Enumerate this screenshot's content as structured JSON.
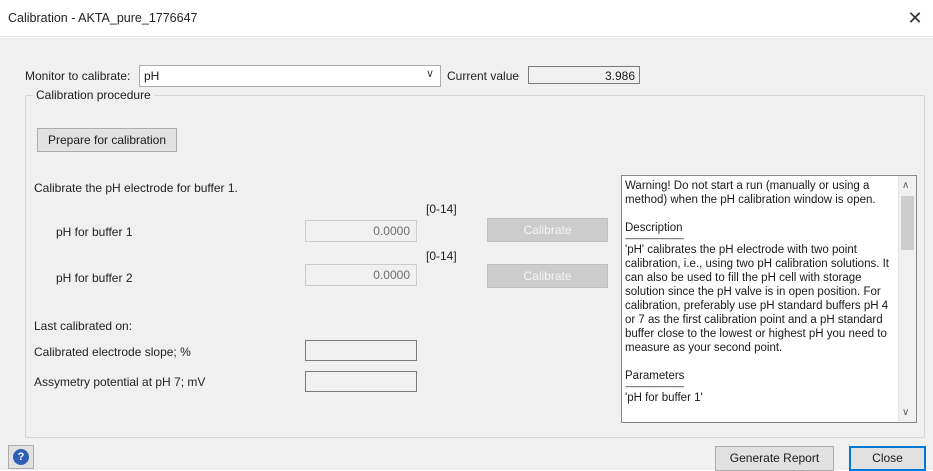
{
  "window": {
    "title": "Calibration - AKTA_pure_1776647",
    "close_symbol": "✕"
  },
  "monitor": {
    "label": "Monitor to calibrate:",
    "selected": "pH",
    "current_value_label": "Current value",
    "current_value": "3.986"
  },
  "procedure": {
    "group_title": "Calibration procedure",
    "prepare_button": "Prepare for calibration",
    "instruction": "Calibrate the pH electrode for buffer 1.",
    "buffers": [
      {
        "label": "pH for buffer 1",
        "range": "[0-14]",
        "value": "0.0000",
        "button": "Calibrate"
      },
      {
        "label": "pH for buffer 2",
        "range": "[0-14]",
        "value": "0.0000",
        "button": "Calibrate"
      }
    ],
    "last_calibrated": "Last calibrated on:",
    "slope_label": "Calibrated electrode slope; %",
    "asym_label": "Assymetry potential at pH 7; mV"
  },
  "description": {
    "warning": "Warning! Do not start a run (manually or using a method) when the pH calibration window is open.",
    "heading": "Description",
    "divider": "-----------------------------------",
    "body": "'pH' calibrates the pH electrode with two point calibration, i.e., using two pH calibration solutions. It can also be used to fill the pH cell with storage solution since the pH valve is in open position. For calibration, preferably use pH standard buffers pH 4 or 7 as the first calibration point and a pH standard buffer close to the lowest or highest pH you need to measure as your second point.",
    "params_heading": "Parameters",
    "params_divider": "-----------------------------------",
    "params_cut": "'pH for buffer 1'"
  },
  "footer": {
    "help": "?",
    "generate_report": "Generate Report",
    "close": "Close"
  }
}
